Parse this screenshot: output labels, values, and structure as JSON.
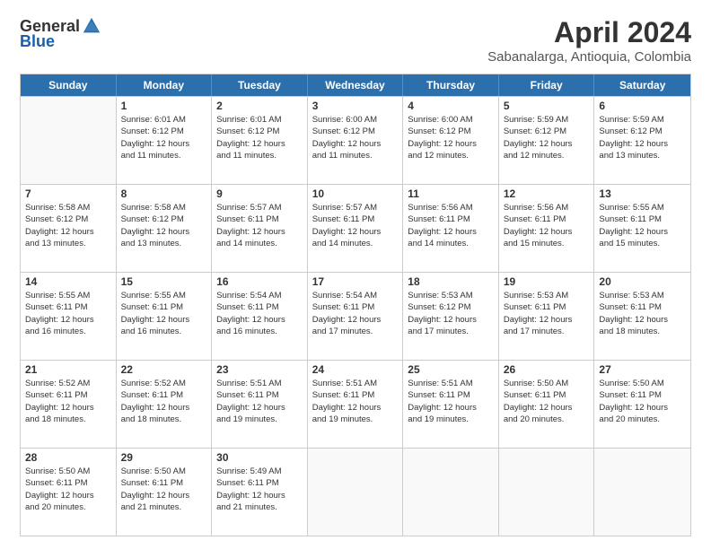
{
  "logo": {
    "general": "General",
    "blue": "Blue"
  },
  "title": "April 2024",
  "subtitle": "Sabanalarga, Antioquia, Colombia",
  "header_days": [
    "Sunday",
    "Monday",
    "Tuesday",
    "Wednesday",
    "Thursday",
    "Friday",
    "Saturday"
  ],
  "weeks": [
    [
      {
        "day": "",
        "info": ""
      },
      {
        "day": "1",
        "info": "Sunrise: 6:01 AM\nSunset: 6:12 PM\nDaylight: 12 hours\nand 11 minutes."
      },
      {
        "day": "2",
        "info": "Sunrise: 6:01 AM\nSunset: 6:12 PM\nDaylight: 12 hours\nand 11 minutes."
      },
      {
        "day": "3",
        "info": "Sunrise: 6:00 AM\nSunset: 6:12 PM\nDaylight: 12 hours\nand 11 minutes."
      },
      {
        "day": "4",
        "info": "Sunrise: 6:00 AM\nSunset: 6:12 PM\nDaylight: 12 hours\nand 12 minutes."
      },
      {
        "day": "5",
        "info": "Sunrise: 5:59 AM\nSunset: 6:12 PM\nDaylight: 12 hours\nand 12 minutes."
      },
      {
        "day": "6",
        "info": "Sunrise: 5:59 AM\nSunset: 6:12 PM\nDaylight: 12 hours\nand 13 minutes."
      }
    ],
    [
      {
        "day": "7",
        "info": "Sunrise: 5:58 AM\nSunset: 6:12 PM\nDaylight: 12 hours\nand 13 minutes."
      },
      {
        "day": "8",
        "info": "Sunrise: 5:58 AM\nSunset: 6:12 PM\nDaylight: 12 hours\nand 13 minutes."
      },
      {
        "day": "9",
        "info": "Sunrise: 5:57 AM\nSunset: 6:11 PM\nDaylight: 12 hours\nand 14 minutes."
      },
      {
        "day": "10",
        "info": "Sunrise: 5:57 AM\nSunset: 6:11 PM\nDaylight: 12 hours\nand 14 minutes."
      },
      {
        "day": "11",
        "info": "Sunrise: 5:56 AM\nSunset: 6:11 PM\nDaylight: 12 hours\nand 14 minutes."
      },
      {
        "day": "12",
        "info": "Sunrise: 5:56 AM\nSunset: 6:11 PM\nDaylight: 12 hours\nand 15 minutes."
      },
      {
        "day": "13",
        "info": "Sunrise: 5:55 AM\nSunset: 6:11 PM\nDaylight: 12 hours\nand 15 minutes."
      }
    ],
    [
      {
        "day": "14",
        "info": "Sunrise: 5:55 AM\nSunset: 6:11 PM\nDaylight: 12 hours\nand 16 minutes."
      },
      {
        "day": "15",
        "info": "Sunrise: 5:55 AM\nSunset: 6:11 PM\nDaylight: 12 hours\nand 16 minutes."
      },
      {
        "day": "16",
        "info": "Sunrise: 5:54 AM\nSunset: 6:11 PM\nDaylight: 12 hours\nand 16 minutes."
      },
      {
        "day": "17",
        "info": "Sunrise: 5:54 AM\nSunset: 6:11 PM\nDaylight: 12 hours\nand 17 minutes."
      },
      {
        "day": "18",
        "info": "Sunrise: 5:53 AM\nSunset: 6:12 PM\nDaylight: 12 hours\nand 17 minutes."
      },
      {
        "day": "19",
        "info": "Sunrise: 5:53 AM\nSunset: 6:11 PM\nDaylight: 12 hours\nand 17 minutes."
      },
      {
        "day": "20",
        "info": "Sunrise: 5:53 AM\nSunset: 6:11 PM\nDaylight: 12 hours\nand 18 minutes."
      }
    ],
    [
      {
        "day": "21",
        "info": "Sunrise: 5:52 AM\nSunset: 6:11 PM\nDaylight: 12 hours\nand 18 minutes."
      },
      {
        "day": "22",
        "info": "Sunrise: 5:52 AM\nSunset: 6:11 PM\nDaylight: 12 hours\nand 18 minutes."
      },
      {
        "day": "23",
        "info": "Sunrise: 5:51 AM\nSunset: 6:11 PM\nDaylight: 12 hours\nand 19 minutes."
      },
      {
        "day": "24",
        "info": "Sunrise: 5:51 AM\nSunset: 6:11 PM\nDaylight: 12 hours\nand 19 minutes."
      },
      {
        "day": "25",
        "info": "Sunrise: 5:51 AM\nSunset: 6:11 PM\nDaylight: 12 hours\nand 19 minutes."
      },
      {
        "day": "26",
        "info": "Sunrise: 5:50 AM\nSunset: 6:11 PM\nDaylight: 12 hours\nand 20 minutes."
      },
      {
        "day": "27",
        "info": "Sunrise: 5:50 AM\nSunset: 6:11 PM\nDaylight: 12 hours\nand 20 minutes."
      }
    ],
    [
      {
        "day": "28",
        "info": "Sunrise: 5:50 AM\nSunset: 6:11 PM\nDaylight: 12 hours\nand 20 minutes."
      },
      {
        "day": "29",
        "info": "Sunrise: 5:50 AM\nSunset: 6:11 PM\nDaylight: 12 hours\nand 21 minutes."
      },
      {
        "day": "30",
        "info": "Sunrise: 5:49 AM\nSunset: 6:11 PM\nDaylight: 12 hours\nand 21 minutes."
      },
      {
        "day": "",
        "info": ""
      },
      {
        "day": "",
        "info": ""
      },
      {
        "day": "",
        "info": ""
      },
      {
        "day": "",
        "info": ""
      }
    ]
  ]
}
